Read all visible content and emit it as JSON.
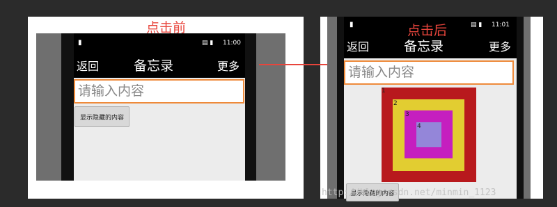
{
  "before": {
    "caption": "点击前",
    "status": {
      "time": "11:00",
      "icons": "▤ ▮"
    },
    "actionbar": {
      "back": "返回",
      "title": "备忘录",
      "more": "更多"
    },
    "input": {
      "placeholder": "请输入内容"
    },
    "button": {
      "label": "显示隐藏的内容"
    }
  },
  "after": {
    "caption": "点击后",
    "status": {
      "time": "11:01",
      "icons": "▤ ▮"
    },
    "actionbar": {
      "back": "返回",
      "title": "备忘录",
      "more": "更多"
    },
    "input": {
      "placeholder": "请输入内容"
    },
    "button": {
      "label": "显示隐藏的内容"
    },
    "squares": [
      {
        "label": "1",
        "color": "#b8191d"
      },
      {
        "label": "2",
        "color": "#e2cd31"
      },
      {
        "label": "3",
        "color": "#c51fbf"
      },
      {
        "label": "4",
        "color": "#9486d9"
      }
    ]
  },
  "watermark": "http://blog.csdn.net/minmin_1123"
}
